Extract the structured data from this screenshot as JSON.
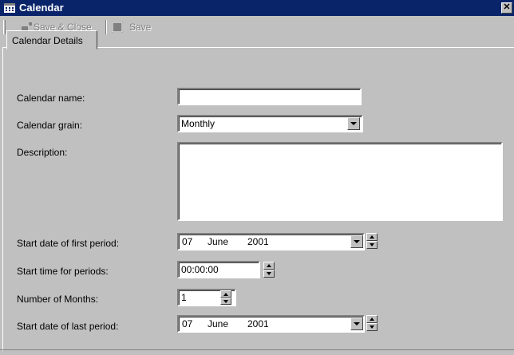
{
  "window": {
    "title": "Calendar",
    "close_glyph": "✕"
  },
  "toolbar": {
    "save_close_label": "Save & Close",
    "save_label": "Save"
  },
  "tabs": [
    {
      "label": "Calendar Details"
    }
  ],
  "form": {
    "calendar_name_label": "Calendar name:",
    "calendar_name_value": "",
    "calendar_grain_label": "Calendar grain:",
    "calendar_grain_value": "Monthly",
    "description_label": "Description:",
    "description_value": "",
    "start_first_label": "Start date of first period:",
    "start_first": {
      "day": "07",
      "month": "June",
      "year": "2001"
    },
    "start_time_label": "Start time for periods:",
    "start_time_value": "00:00:00",
    "num_months_label": "Number of Months:",
    "num_months_value": "1",
    "start_last_label": "Start date of last period:",
    "start_last": {
      "day": "07",
      "month": "June",
      "year": "2001"
    }
  },
  "icons": {
    "window": "calendar-icon",
    "save_close": "save-close-icon",
    "save": "save-icon",
    "dropdown": "chevron-down-icon",
    "spin_up": "chevron-up-icon",
    "spin_down": "chevron-down-icon"
  }
}
